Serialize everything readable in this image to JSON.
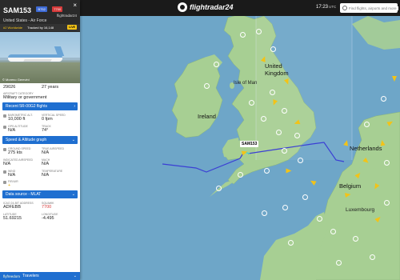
{
  "topbar": {
    "logo_text": "flightradar24",
    "clock_time": "17:23",
    "clock_tz": "UTC",
    "search_placeholder": "Find flights, airports and more"
  },
  "flight": {
    "callsign": "SAM153",
    "badge_blue": "B752",
    "badge_red": "7700",
    "airline": "United States - Air Force",
    "f24_brand": "flightradar24",
    "subbar_left": "#2 Worldwide",
    "subbar_mid": "Tracked by 16,148",
    "live_label": "LIVE",
    "photo_credit": "© Moreno Gerevini"
  },
  "details": {
    "msn": "29026",
    "age": "27 years",
    "category_key": "AIRCRAFT CATEGORY",
    "category_val": "Military or government",
    "section_recent": "Recent 5R-00G2 flights",
    "baro_key": "BAROMETRIC ALT.",
    "baro_val": "10,000 ft",
    "vs_key": "VERTICAL SPEED",
    "vs_val": "0 fpm",
    "gps_key": "GPS ALTITUDE",
    "gps_val": "N/A",
    "track_key": "TRACK",
    "track_val": "74°",
    "section_speed": "Speed & Altitude graph",
    "gs_key": "GROUND SPEED",
    "gs_val": "275 kts",
    "tas_key": "TRUE AIRSPEED",
    "tas_val": "N/A",
    "ias_key": "INDICATED AIRSPEED",
    "ias_val": "N/A",
    "mach_key": "MACH",
    "mach_val": "N/A",
    "wind_key": "WIND",
    "wind_val": "N/A",
    "temp_key": "TEMPERATURE",
    "temp_val": "N/A",
    "fir_key": "FIR/UIR",
    "fir_val": "+",
    "section_source": "Data source - MLAT",
    "icao_key": "ICAO 24-BIT ADDRESS",
    "icao_val": "ADFEBB",
    "squawk_key": "SQUAWK",
    "squawk_val": "7700",
    "lat_key": "LATITUDE",
    "lat_val": "51.69215",
    "lon_key": "LONGITUDE",
    "lon_val": "-4.495",
    "footer_brand": "flyfreedom",
    "footer_label": "Travelers"
  },
  "map": {
    "labels": {
      "uk": "United\nKingdom",
      "iom": "Isle of Man",
      "ireland": "Ireland",
      "netherlands": "Netherlands",
      "belgium": "Belgium",
      "luxembourg": "Luxembourg",
      "callsign_tag": "SAM153"
    },
    "colors": {
      "sea": "#6ea6c8",
      "land": "#a7cf93",
      "track": "#3b3fd4",
      "plane": "#f3c317",
      "emergency": "#d63b3b"
    }
  }
}
